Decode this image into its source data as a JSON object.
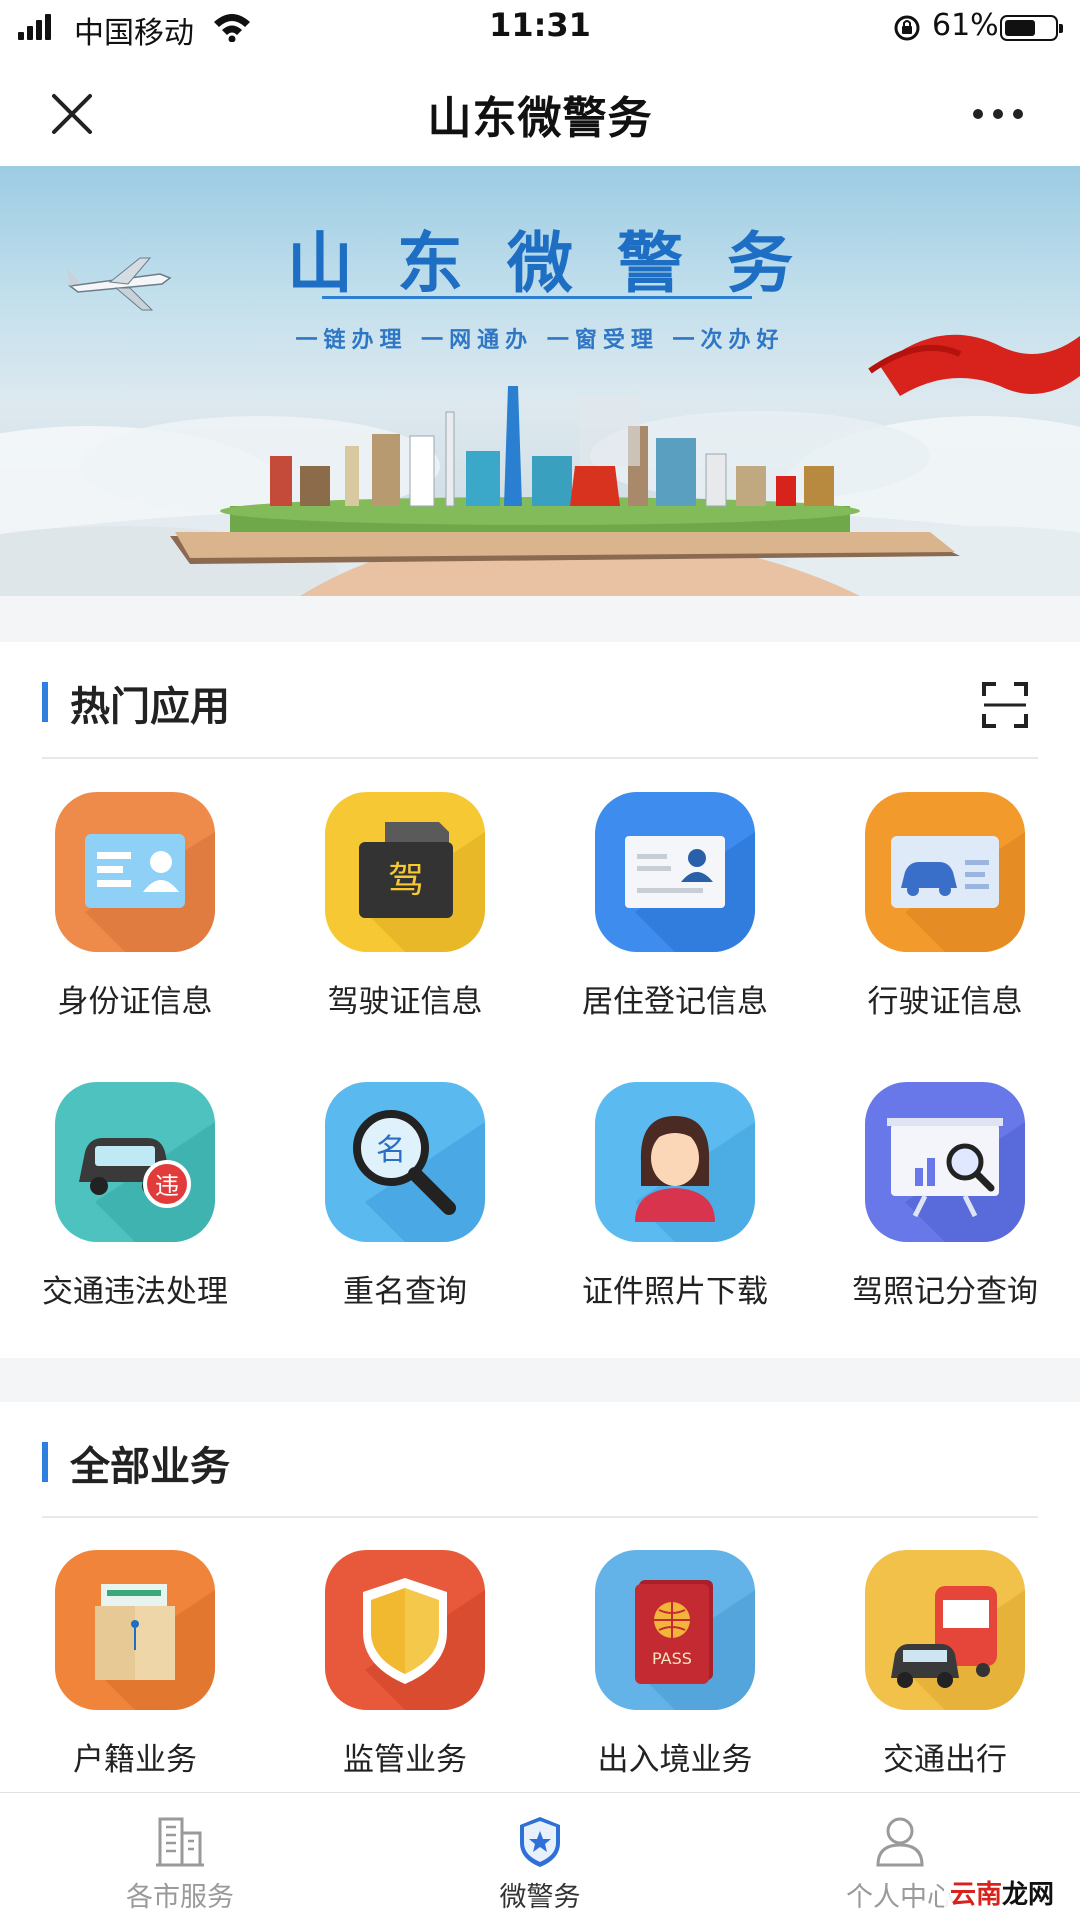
{
  "status_bar": {
    "carrier": "中国移动",
    "time": "11:31",
    "battery_percent": "61%"
  },
  "nav": {
    "title": "山东微警务"
  },
  "banner": {
    "title": "山东微警务",
    "slogan": "一链办理  一网通办  一窗受理  一次办好"
  },
  "hot_apps": {
    "title": "热门应用",
    "items": [
      {
        "label": "身份证信息",
        "icon": "id-card-icon",
        "bg": "#ee8a4a"
      },
      {
        "label": "驾驶证信息",
        "icon": "driver-license-icon",
        "bg": "#f6c934"
      },
      {
        "label": "居住登记信息",
        "icon": "residence-card-icon",
        "bg": "#3d8cee"
      },
      {
        "label": "行驶证信息",
        "icon": "vehicle-license-icon",
        "bg": "#f39a2c"
      },
      {
        "label": "交通违法处理",
        "icon": "traffic-violation-icon",
        "bg": "#4dc2be"
      },
      {
        "label": "重名查询",
        "icon": "name-search-icon",
        "bg": "#5ab9ef"
      },
      {
        "label": "证件照片下载",
        "icon": "photo-download-icon",
        "bg": "#5bbbf0"
      },
      {
        "label": "驾照记分查询",
        "icon": "license-points-icon",
        "bg": "#6878e8"
      }
    ]
  },
  "all_business": {
    "title": "全部业务",
    "items": [
      {
        "label": "户籍业务",
        "icon": "household-register-icon",
        "bg": "#f0843a"
      },
      {
        "label": "监管业务",
        "icon": "shield-icon",
        "bg": "#e8583a"
      },
      {
        "label": "出入境业务",
        "icon": "passport-icon",
        "bg": "#63b3e8"
      },
      {
        "label": "交通出行",
        "icon": "transport-icon",
        "bg": "#f2c14a"
      }
    ]
  },
  "icon_glyphs": {
    "driver": "驾",
    "violation": "违",
    "name": "名",
    "passport": "PASS"
  },
  "tab_bar": {
    "items": [
      {
        "label": "各市服务",
        "icon": "city-building-icon",
        "active": false
      },
      {
        "label": "微警务",
        "icon": "police-badge-icon",
        "active": true
      },
      {
        "label": "个人中心",
        "icon": "person-icon",
        "active": false
      }
    ]
  },
  "watermark": {
    "prefix": "云南",
    "rest": "龙网"
  }
}
